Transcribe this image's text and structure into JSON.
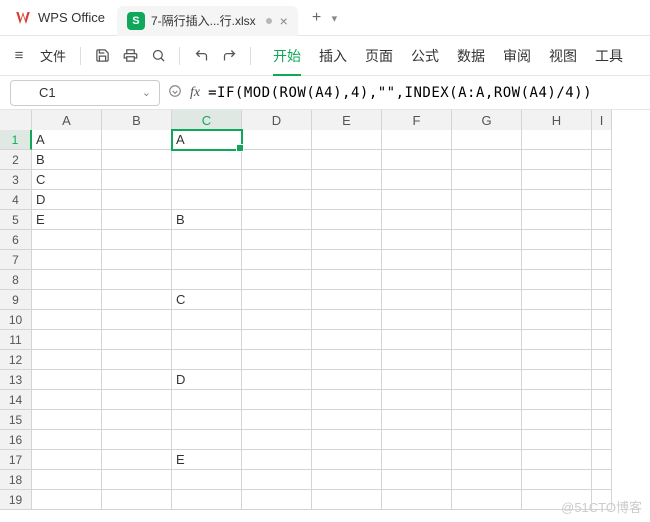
{
  "app": {
    "name": "WPS Office"
  },
  "tab": {
    "doc_icon": "S",
    "title": "7-隔行插入...行.xlsx"
  },
  "newtab_glyph": "+",
  "menu": {
    "file": "文件",
    "tabs": [
      "开始",
      "插入",
      "页面",
      "公式",
      "数据",
      "审阅",
      "视图",
      "工具"
    ],
    "active_index": 0
  },
  "namebox": {
    "value": "C1"
  },
  "fx": {
    "label": "fx"
  },
  "formula": "=IF(MOD(ROW(A4),4),\"\",INDEX(A:A,ROW(A4)/4))",
  "columns": [
    "A",
    "B",
    "C",
    "D",
    "E",
    "F",
    "G",
    "H",
    "I"
  ],
  "active_col_index": 2,
  "active_row_index": 0,
  "rows": [
    {
      "n": 1,
      "cells": [
        "A",
        "",
        "A",
        "",
        "",
        "",
        "",
        "",
        ""
      ]
    },
    {
      "n": 2,
      "cells": [
        "B",
        "",
        "",
        "",
        "",
        "",
        "",
        "",
        ""
      ]
    },
    {
      "n": 3,
      "cells": [
        "C",
        "",
        "",
        "",
        "",
        "",
        "",
        "",
        ""
      ]
    },
    {
      "n": 4,
      "cells": [
        "D",
        "",
        "",
        "",
        "",
        "",
        "",
        "",
        ""
      ]
    },
    {
      "n": 5,
      "cells": [
        "E",
        "",
        "B",
        "",
        "",
        "",
        "",
        "",
        ""
      ]
    },
    {
      "n": 6,
      "cells": [
        "",
        "",
        "",
        "",
        "",
        "",
        "",
        "",
        ""
      ]
    },
    {
      "n": 7,
      "cells": [
        "",
        "",
        "",
        "",
        "",
        "",
        "",
        "",
        ""
      ]
    },
    {
      "n": 8,
      "cells": [
        "",
        "",
        "",
        "",
        "",
        "",
        "",
        "",
        ""
      ]
    },
    {
      "n": 9,
      "cells": [
        "",
        "",
        "C",
        "",
        "",
        "",
        "",
        "",
        ""
      ]
    },
    {
      "n": 10,
      "cells": [
        "",
        "",
        "",
        "",
        "",
        "",
        "",
        "",
        ""
      ]
    },
    {
      "n": 11,
      "cells": [
        "",
        "",
        "",
        "",
        "",
        "",
        "",
        "",
        ""
      ]
    },
    {
      "n": 12,
      "cells": [
        "",
        "",
        "",
        "",
        "",
        "",
        "",
        "",
        ""
      ]
    },
    {
      "n": 13,
      "cells": [
        "",
        "",
        "D",
        "",
        "",
        "",
        "",
        "",
        ""
      ]
    },
    {
      "n": 14,
      "cells": [
        "",
        "",
        "",
        "",
        "",
        "",
        "",
        "",
        ""
      ]
    },
    {
      "n": 15,
      "cells": [
        "",
        "",
        "",
        "",
        "",
        "",
        "",
        "",
        ""
      ]
    },
    {
      "n": 16,
      "cells": [
        "",
        "",
        "",
        "",
        "",
        "",
        "",
        "",
        ""
      ]
    },
    {
      "n": 17,
      "cells": [
        "",
        "",
        "E",
        "",
        "",
        "",
        "",
        "",
        ""
      ]
    },
    {
      "n": 18,
      "cells": [
        "",
        "",
        "",
        "",
        "",
        "",
        "",
        "",
        ""
      ]
    },
    {
      "n": 19,
      "cells": [
        "",
        "",
        "",
        "",
        "",
        "",
        "",
        "",
        ""
      ]
    }
  ],
  "watermark": "@51CTO博客"
}
